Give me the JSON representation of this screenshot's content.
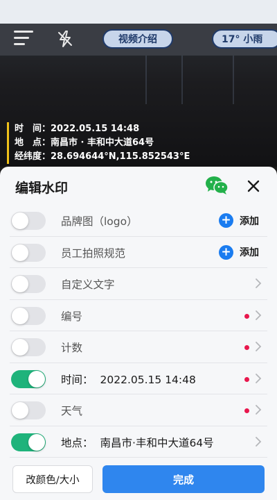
{
  "camera": {
    "video_intro_label": "视频介绍",
    "weather_label": "17° 小雨",
    "icons": {
      "menu": "menu-icon",
      "flash": "flash-off-icon"
    },
    "watermark": {
      "time": "时　间：2022.05.15 14:48",
      "location": "地　点：南昌市 · 丰和中大道64号",
      "coords": "经纬度：28.694644°N,115.852543°E",
      "accent_color": "#f0c21a"
    }
  },
  "sheet": {
    "title": "编辑水印",
    "icons": {
      "wechat": "wechat-icon",
      "close": "close-icon"
    },
    "rows": [
      {
        "label": "品牌图（logo）",
        "on": false,
        "action": "添加"
      },
      {
        "label": "员工拍照规范",
        "on": false,
        "action": "添加"
      },
      {
        "label": "自定义文字",
        "on": false
      },
      {
        "label": "编号",
        "on": false,
        "dot": true
      },
      {
        "label": "计数",
        "on": false,
        "dot": true
      },
      {
        "label": "时间：",
        "value": "2022.05.15 14:48",
        "on": true,
        "dot": true
      },
      {
        "label": "天气",
        "on": false,
        "dot": true
      },
      {
        "label": "地点：",
        "value": "南昌市·丰和中大道64号",
        "on": true
      }
    ],
    "footer": {
      "color_size_label": "改颜色/大小",
      "done_label": "完成"
    }
  },
  "colors": {
    "toggle_on": "#1fb37b",
    "primary": "#2f86ee",
    "add_blue": "#1a7cf0",
    "dot_red": "#e8174d"
  }
}
